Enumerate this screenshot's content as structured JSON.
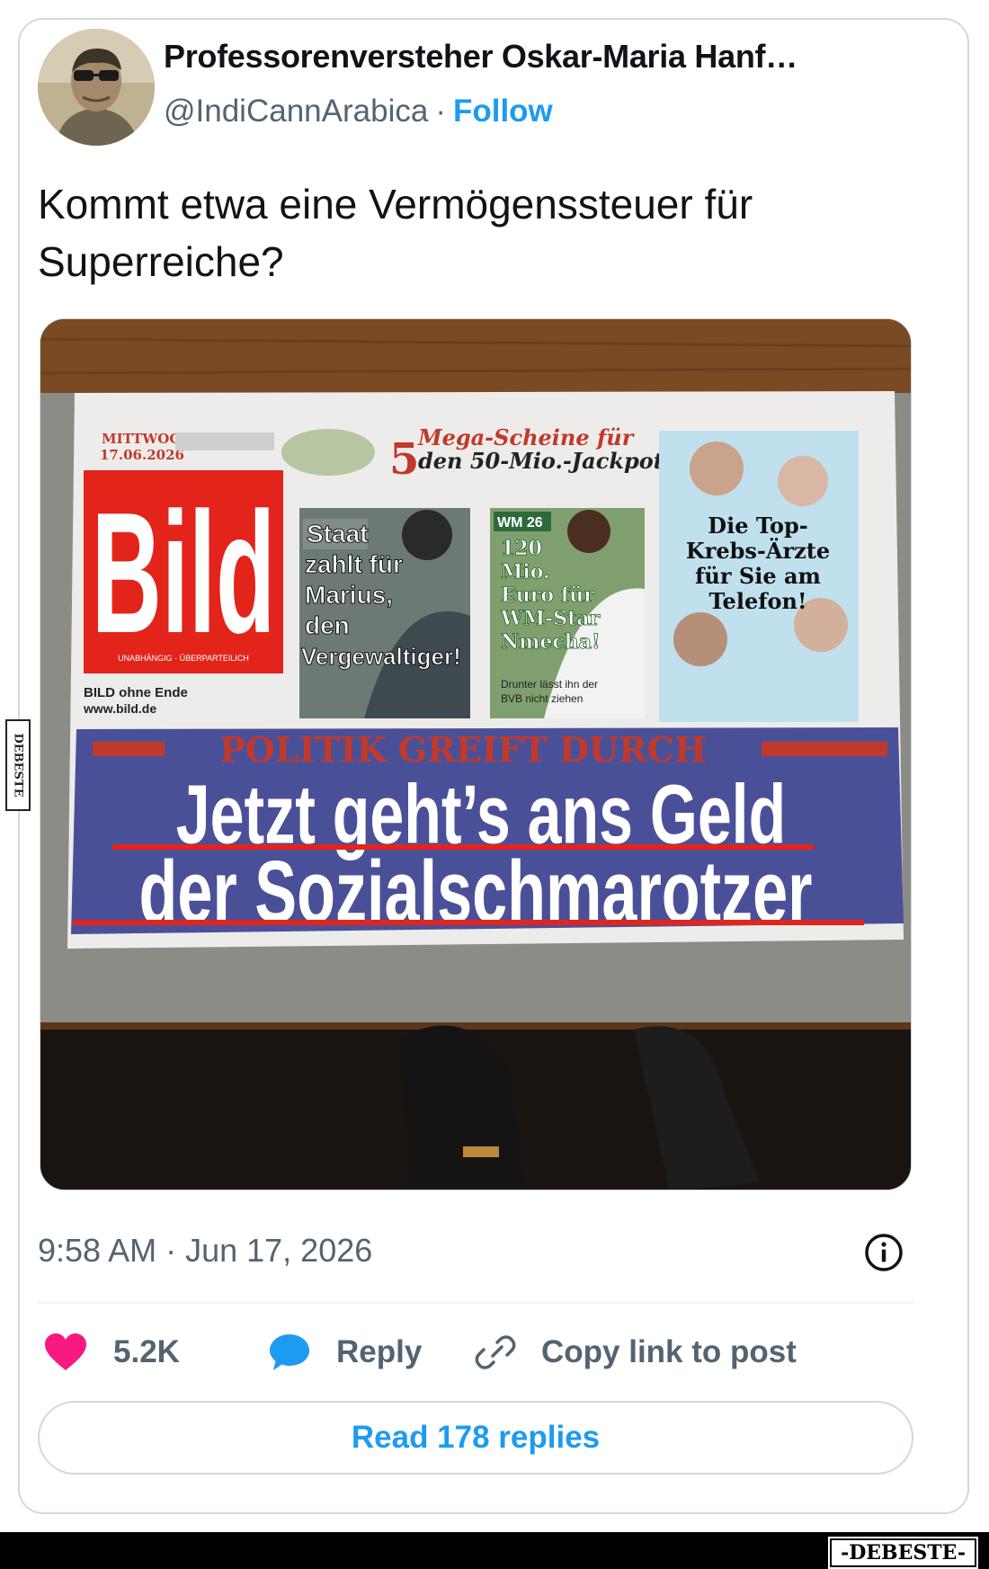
{
  "author": {
    "name": "Professorenversteher Oskar-Maria Hanf…",
    "handle": "@IndiCannArabica",
    "separator": "·",
    "follow_label": "Follow"
  },
  "tweet": {
    "text": "Kommt etwa eine Vermögenssteuer für Superreiche?",
    "timestamp": "9:58 AM · Jun 17, 2026"
  },
  "newspaper": {
    "date_line_1": "MITTWOCH,",
    "date_line_2": "17.06.2026",
    "masthead": "Bild",
    "masthead_tagline": "UNABHÄNGIG · ÜBERPARTEILICH",
    "ohne_ende": "BILD ohne Ende",
    "website": "www.bild.de",
    "promo_number": "5",
    "promo_line_1": "Mega-Scheine für",
    "promo_line_2": "den 50-Mio.-Jackpot!",
    "story1_lines": [
      "Staat",
      "zahlt für",
      "Marius,",
      "den",
      "Vergewaltiger!"
    ],
    "story2_badge": "WM 26",
    "story2_lines": [
      "120",
      "Mio.",
      "Euro für",
      "WM-Star",
      "Nmecha!"
    ],
    "story2_sub_1": "Drunter lässt ihn der",
    "story2_sub_2": "BVB nicht ziehen",
    "story3_lines": [
      "Die Top-",
      "Krebs-Ärzte",
      "für Sie am",
      "Telefon!"
    ],
    "kicker": "POLITIK GREIFT DURCH",
    "headline_1": "Jetzt geht’s ans Geld",
    "headline_2": "der Sozialschmarotzer"
  },
  "actions": {
    "like_count": "5.2K",
    "reply_label": "Reply",
    "copy_label": "Copy link to post",
    "read_replies_label": "Read 178 replies"
  },
  "watermark": {
    "side_text": "DEBESTE",
    "footer_text": "-DEBESTE-"
  },
  "colors": {
    "like": "#f91880",
    "link": "#1d9bf0",
    "muted": "#536471",
    "bild_red": "#e3241b",
    "headline_band": "#4a5098"
  },
  "icons": {
    "like": "heart-icon",
    "reply": "speech-bubble-icon",
    "copy": "link-icon",
    "info": "info-icon"
  }
}
